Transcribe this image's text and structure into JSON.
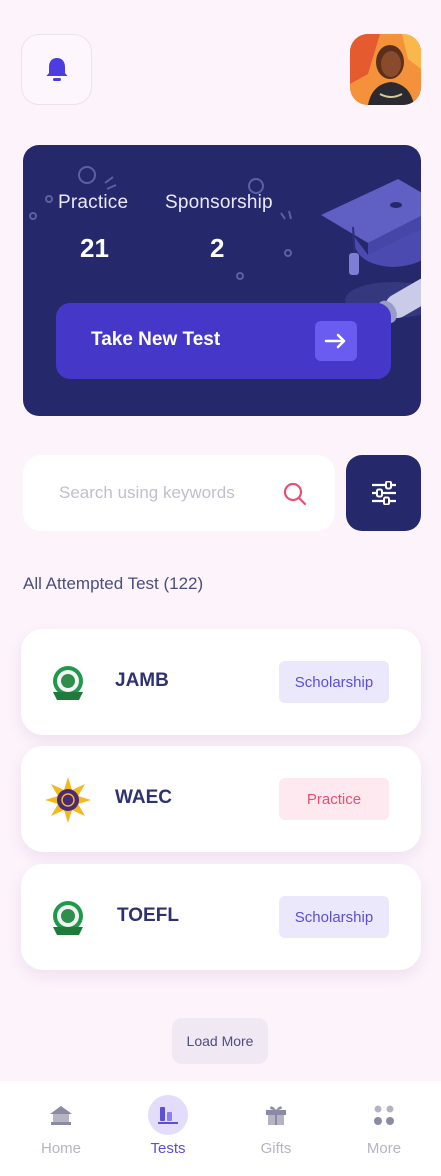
{
  "header": {
    "avatar_alt": "",
    "colors": {
      "bell": "#4b3de0"
    }
  },
  "hero": {
    "stats": [
      {
        "label": "Practice",
        "value": "21"
      },
      {
        "label": "Sponsorship",
        "value": "2"
      }
    ],
    "cta_label": "Take New Test",
    "colors": {
      "background": "#25286b",
      "button": "#4538c8",
      "arrow": "#6a5cf0"
    }
  },
  "search": {
    "placeholder": "Search using keywords"
  },
  "section": {
    "title": "All Attempted Test (122)"
  },
  "tests": [
    {
      "name": "JAMB",
      "tag": "Scholarship",
      "tag_kind": "scholarship"
    },
    {
      "name": "WAEC",
      "tag": "Practice",
      "tag_kind": "practice"
    },
    {
      "name": "TOEFL",
      "tag": "Scholarship",
      "tag_kind": "scholarship"
    }
  ],
  "load_more_label": "Load More",
  "nav": {
    "items": [
      {
        "label": "Home",
        "icon": "home-icon",
        "active": false
      },
      {
        "label": "Tests",
        "icon": "tests-icon",
        "active": true
      },
      {
        "label": "Gifts",
        "icon": "gift-icon",
        "active": false
      },
      {
        "label": "More",
        "icon": "more-dots-icon",
        "active": false
      }
    ],
    "colors": {
      "active": "#5b4fd6",
      "inactive": "#b5b4c3"
    }
  }
}
